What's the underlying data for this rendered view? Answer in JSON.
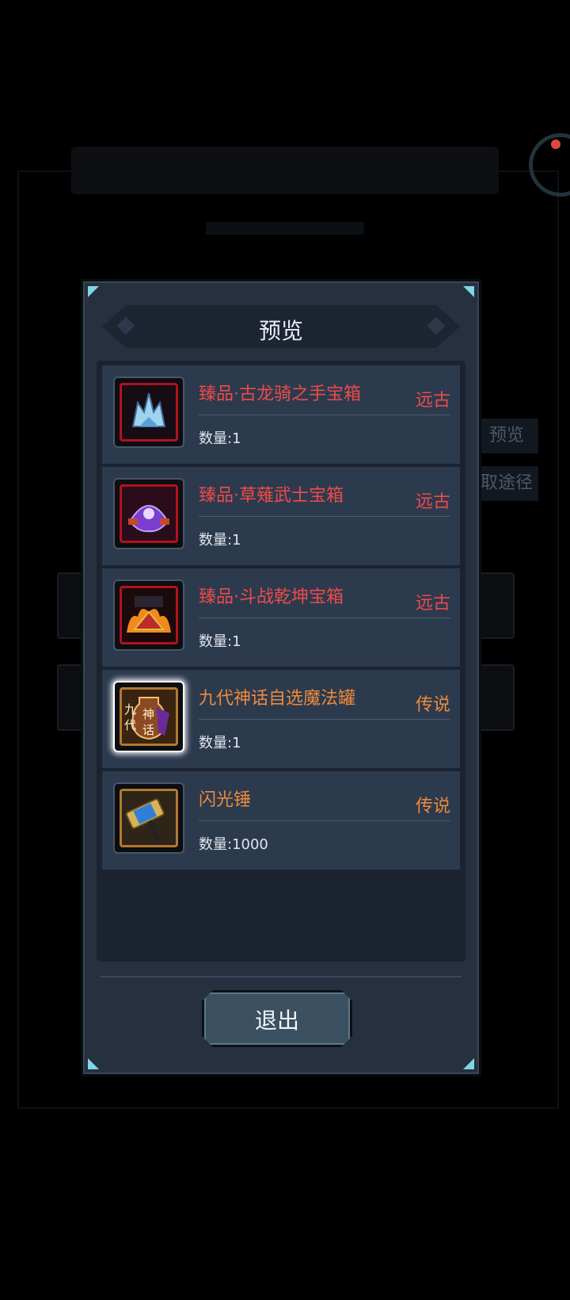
{
  "background": {
    "side_buttons": [
      "预览",
      "取途径"
    ]
  },
  "dialog": {
    "title": "预览",
    "exit_label": "退出",
    "items": [
      {
        "name": "臻品·古龙骑之手宝箱",
        "rarity": "远古",
        "rarity_color": "#ee4a48",
        "quantity_label": "数量:",
        "quantity": "1",
        "icon": "dragon-claw-chest-icon"
      },
      {
        "name": "臻品·草薙武士宝箱",
        "rarity": "远古",
        "rarity_color": "#ee4a48",
        "quantity_label": "数量:",
        "quantity": "1",
        "icon": "samurai-helmet-chest-icon"
      },
      {
        "name": "臻品·斗战乾坤宝箱",
        "rarity": "远古",
        "rarity_color": "#ee4a48",
        "quantity_label": "数量:",
        "quantity": "1",
        "icon": "battle-crown-chest-icon"
      },
      {
        "name": "九代神话自选魔法罐",
        "rarity": "传说",
        "rarity_color": "#ee8a3a",
        "quantity_label": "数量:",
        "quantity": "1",
        "icon": "magic-jar-icon",
        "icon_text": [
          "九",
          "代",
          "神",
          "话"
        ]
      },
      {
        "name": "闪光锤",
        "rarity": "传说",
        "rarity_color": "#ee8a3a",
        "quantity_label": "数量:",
        "quantity": "1000",
        "icon": "flash-hammer-icon"
      }
    ]
  }
}
